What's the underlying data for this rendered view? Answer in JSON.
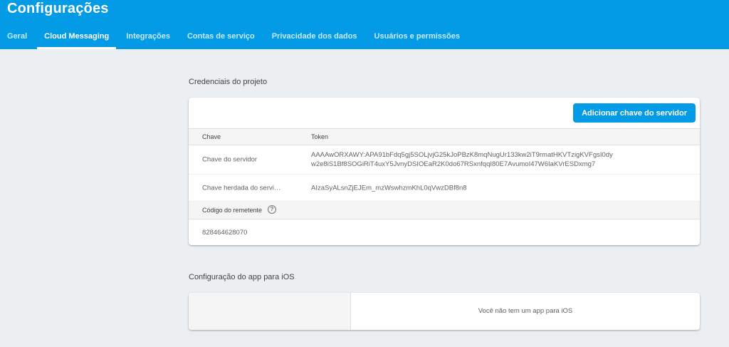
{
  "header": {
    "title": "Configurações",
    "tabs": [
      {
        "label": "Geral",
        "active": false
      },
      {
        "label": "Cloud Messaging",
        "active": true
      },
      {
        "label": "Integrações",
        "active": false
      },
      {
        "label": "Contas de serviço",
        "active": false
      },
      {
        "label": "Privacidade dos dados",
        "active": false
      },
      {
        "label": "Usuários e permissões",
        "active": false
      }
    ]
  },
  "credentials": {
    "section_title": "Credenciais do projeto",
    "add_key_label": "Adicionar chave do servidor",
    "columns": {
      "key": "Chave",
      "token": "Token"
    },
    "rows": [
      {
        "key": "Chave do servidor",
        "token_line1": "AAAAwORXAWY:APA91bFdq5gj5SOLjvjG25kJoPBzK8mqNugUr133kw2iT9rmatHKVTzigKVFgsI0dy",
        "token_line2": "w2e8iS1Bf8SOGiRiT4uxY5JvnyDSIOEaR2K0do67RSxnfqqI80E7AvumoI47W6IaKVrESDxmg7"
      },
      {
        "key": "Chave herdada do servi…",
        "token_line1": "AIzaSyALsnZjEJEm_mzWswhzmKhL0qVwzDBf8n8"
      }
    ],
    "sender_label": "Código do remetente",
    "sender_value": "828464628070"
  },
  "ios": {
    "section_title": "Configuração do app para iOS",
    "empty_message": "Você não tem um app para iOS"
  },
  "colors": {
    "header_bg": "#039be5",
    "button_bg": "#039be5",
    "page_bg": "#eceff1"
  },
  "icons": {
    "help": "help-circle-icon"
  }
}
